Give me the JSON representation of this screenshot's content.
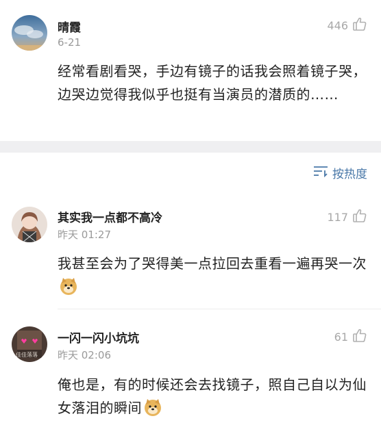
{
  "comments": [
    {
      "user": "晴霞",
      "time": "6-21",
      "likes": "446",
      "text": "经常看剧看哭，手边有镜子的话我会照着镜子哭，边哭边觉得我似乎也挺有当演员的潜质的……"
    },
    {
      "user": "其实我一点都不高冷",
      "time": "昨天 01:27",
      "likes": "117",
      "text": "我甚至会为了哭得美一点拉回去重看一遍再哭一次"
    },
    {
      "user": "一闪一闪小坑坑",
      "time": "昨天 02:06",
      "likes": "61",
      "text": "俺也是，有的时候还会去找镜子，照自己自以为仙女落泪的瞬间",
      "avatar_text": "佳佳落落"
    }
  ],
  "sort": {
    "label": "按热度"
  },
  "icons": {
    "like": "thumbs-up-icon",
    "sort": "sort-lines-icon",
    "emoji": "doge-emoji-icon"
  }
}
